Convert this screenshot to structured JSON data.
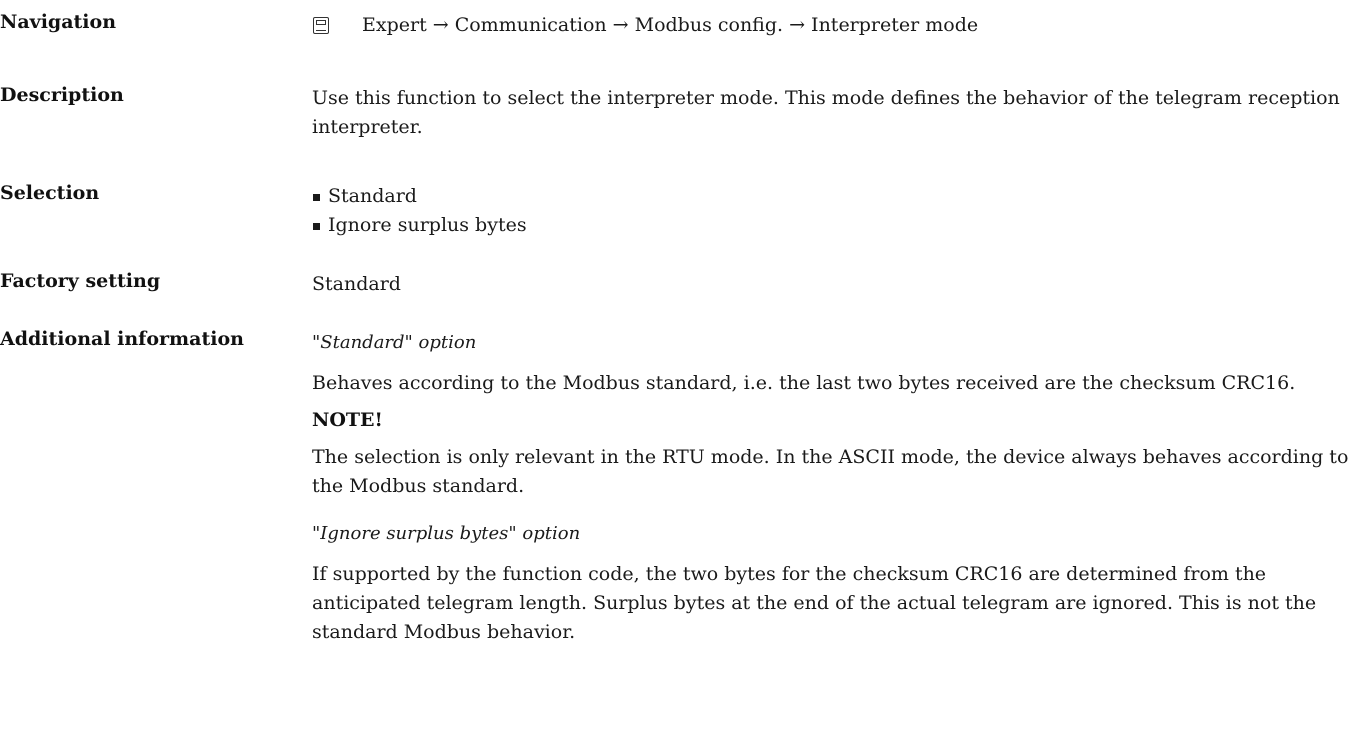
{
  "navigation": {
    "label": "Navigation",
    "icon": "menu-display-icon",
    "path": "Expert → Communication → Modbus config. → Interpreter mode"
  },
  "description": {
    "label": "Description",
    "text": "Use this function to select the interpreter mode. This mode defines the behavior of the telegram reception interpreter."
  },
  "selection": {
    "label": "Selection",
    "options": [
      "Standard",
      "Ignore surplus bytes"
    ]
  },
  "factory_setting": {
    "label": "Factory setting",
    "value": "Standard"
  },
  "additional_info": {
    "label": "Additional information",
    "standard_heading": "\"Standard\" option",
    "standard_text": "Behaves according to the Modbus standard, i.e. the last two bytes received are the checksum CRC16.",
    "note_heading": "NOTE!",
    "note_text": "The selection is only relevant in the RTU mode. In the ASCII mode, the device always behaves according to the Modbus standard.",
    "ignore_heading": "\"Ignore surplus bytes\" option",
    "ignore_text": "If supported by the function code, the two bytes for the checksum CRC16 are determined from the anticipated telegram length. Surplus bytes at the end of the actual telegram are ignored. This is not the standard Modbus behavior."
  }
}
